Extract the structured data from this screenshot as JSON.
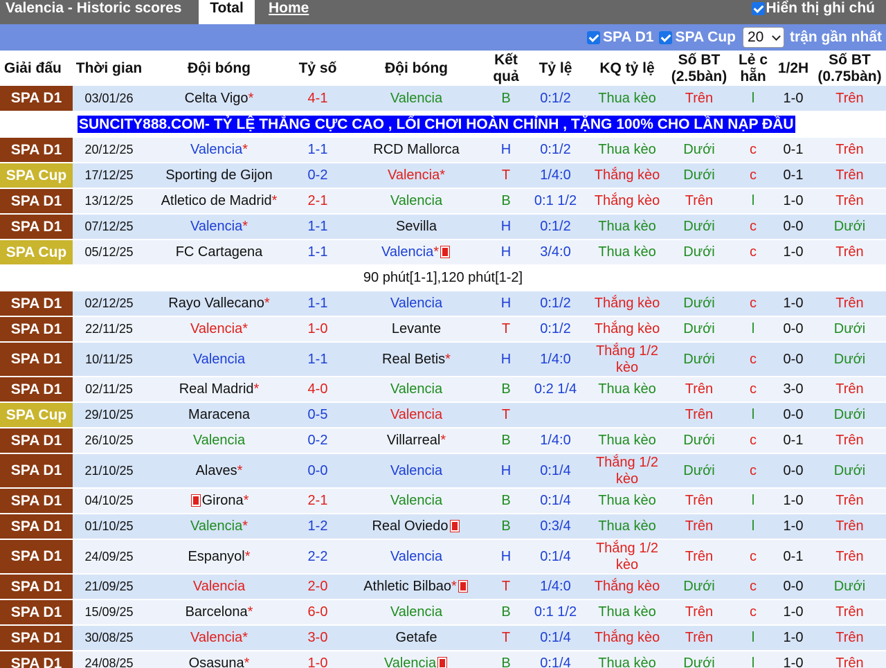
{
  "header": {
    "title": "Valencia - Historic scores",
    "tabs": [
      {
        "label": "Total"
      },
      {
        "label": "Home"
      }
    ],
    "show_note_label": "Hiển thị ghi chú"
  },
  "filters": {
    "league1": "SPA D1",
    "league2": "SPA Cup",
    "count": "20",
    "suffix": "trận gần nhất"
  },
  "columns": [
    "Giải đấu",
    "Thời gian",
    "Đội bóng",
    "Tỷ số",
    "Đội bóng",
    "Kết quả",
    "Tỷ lệ",
    "KQ tỷ lệ",
    "Số BT (2.5bàn)",
    "Lẻ c hẵn",
    "1/2H",
    "Số BT (0.75bàn)"
  ],
  "banner_text": "SUNCITY888.COM- TỶ LỆ THẮNG CỰC CAO , LỐI CHƠI HOÀN CHỈNH , TẶNG 100% CHO LẦN NẠP ĐẦU",
  "note_text": "90 phút[1-1],120 phút[1-2]",
  "colors": {
    "spa_d1": "#8b3a12",
    "spa_cup": "#c9b52e",
    "win": "#e0201c",
    "draw": "#1c3fd6",
    "loss": "#1f8c1f",
    "banner": "#0000ff"
  },
  "rows": [
    {
      "league": "SPA D1",
      "date": "03/01/26",
      "home": "Celta Vigo",
      "home_star": "*",
      "home_card": false,
      "home_color": "dark",
      "score": "4-1",
      "score_color": "red",
      "away": "Valencia",
      "away_star": "",
      "away_card": false,
      "away_color": "green",
      "result": "B",
      "result_color": "green",
      "odds": "0:1/2",
      "odds_result": "Thua kèo",
      "odds_result_color": "green",
      "ou": "Trên",
      "ou_color": "red",
      "oe": "l",
      "oe_color": "green",
      "half": "1-0",
      "ou075": "Trên",
      "ou075_color": "red"
    },
    {
      "league": "SPA D1",
      "date": "20/12/25",
      "home": "Valencia",
      "home_star": "*",
      "home_card": false,
      "home_color": "blue",
      "score": "1-1",
      "score_color": "blue",
      "away": "RCD Mallorca",
      "away_star": "",
      "away_card": false,
      "away_color": "dark",
      "result": "H",
      "result_color": "blue",
      "odds": "0:1/2",
      "odds_result": "Thua kèo",
      "odds_result_color": "green",
      "ou": "Dưới",
      "ou_color": "green",
      "oe": "c",
      "oe_color": "red",
      "half": "0-1",
      "ou075": "Trên",
      "ou075_color": "red"
    },
    {
      "league": "SPA Cup",
      "date": "17/12/25",
      "home": "Sporting de Gijon",
      "home_star": "",
      "home_card": false,
      "home_color": "dark",
      "score": "0-2",
      "score_color": "blue",
      "away": "Valencia",
      "away_star": "*",
      "away_card": false,
      "away_color": "red",
      "result": "T",
      "result_color": "red",
      "odds": "1/4:0",
      "odds_result": "Thắng kèo",
      "odds_result_color": "red",
      "ou": "Dưới",
      "ou_color": "green",
      "oe": "c",
      "oe_color": "red",
      "half": "0-1",
      "ou075": "Trên",
      "ou075_color": "red"
    },
    {
      "league": "SPA D1",
      "date": "13/12/25",
      "home": "Atletico de Madrid",
      "home_star": "*",
      "home_card": false,
      "home_color": "dark",
      "score": "2-1",
      "score_color": "red",
      "away": "Valencia",
      "away_star": "",
      "away_card": false,
      "away_color": "green",
      "result": "B",
      "result_color": "green",
      "odds": "0:1 1/2",
      "odds_result": "Thắng kèo",
      "odds_result_color": "red",
      "ou": "Trên",
      "ou_color": "red",
      "oe": "l",
      "oe_color": "green",
      "half": "1-0",
      "ou075": "Trên",
      "ou075_color": "red"
    },
    {
      "league": "SPA D1",
      "date": "07/12/25",
      "home": "Valencia",
      "home_star": "*",
      "home_card": false,
      "home_color": "blue",
      "score": "1-1",
      "score_color": "blue",
      "away": "Sevilla",
      "away_star": "",
      "away_card": false,
      "away_color": "dark",
      "result": "H",
      "result_color": "blue",
      "odds": "0:1/2",
      "odds_result": "Thua kèo",
      "odds_result_color": "green",
      "ou": "Dưới",
      "ou_color": "green",
      "oe": "c",
      "oe_color": "red",
      "half": "0-0",
      "ou075": "Dưới",
      "ou075_color": "green"
    },
    {
      "league": "SPA Cup",
      "date": "05/12/25",
      "home": "FC Cartagena",
      "home_star": "",
      "home_card": false,
      "home_color": "dark",
      "score": "1-1",
      "score_color": "blue",
      "away": "Valencia",
      "away_star": "*",
      "away_card": true,
      "away_color": "blue",
      "result": "H",
      "result_color": "blue",
      "odds": "3/4:0",
      "odds_result": "Thua kèo",
      "odds_result_color": "green",
      "ou": "Dưới",
      "ou_color": "green",
      "oe": "c",
      "oe_color": "red",
      "half": "1-0",
      "ou075": "Trên",
      "ou075_color": "red"
    },
    {
      "league": "SPA D1",
      "date": "02/12/25",
      "home": "Rayo Vallecano",
      "home_star": "*",
      "home_card": false,
      "home_color": "dark",
      "score": "1-1",
      "score_color": "blue",
      "away": "Valencia",
      "away_star": "",
      "away_card": false,
      "away_color": "blue",
      "result": "H",
      "result_color": "blue",
      "odds": "0:1/2",
      "odds_result": "Thắng kèo",
      "odds_result_color": "red",
      "ou": "Dưới",
      "ou_color": "green",
      "oe": "c",
      "oe_color": "red",
      "half": "1-0",
      "ou075": "Trên",
      "ou075_color": "red"
    },
    {
      "league": "SPA D1",
      "date": "22/11/25",
      "home": "Valencia",
      "home_star": "*",
      "home_card": false,
      "home_color": "red",
      "score": "1-0",
      "score_color": "red",
      "away": "Levante",
      "away_star": "",
      "away_card": false,
      "away_color": "dark",
      "result": "T",
      "result_color": "red",
      "odds": "0:1/2",
      "odds_result": "Thắng kèo",
      "odds_result_color": "red",
      "ou": "Dưới",
      "ou_color": "green",
      "oe": "l",
      "oe_color": "green",
      "half": "0-0",
      "ou075": "Dưới",
      "ou075_color": "green"
    },
    {
      "league": "SPA D1",
      "date": "10/11/25",
      "home": "Valencia",
      "home_star": "",
      "home_card": false,
      "home_color": "blue",
      "score": "1-1",
      "score_color": "blue",
      "away": "Real Betis",
      "away_star": "*",
      "away_card": false,
      "away_color": "dark",
      "result": "H",
      "result_color": "blue",
      "odds": "1/4:0",
      "odds_result": "Thắng 1/2 kèo",
      "odds_result_color": "red",
      "ou": "Dưới",
      "ou_color": "green",
      "oe": "c",
      "oe_color": "red",
      "half": "0-0",
      "ou075": "Dưới",
      "ou075_color": "green"
    },
    {
      "league": "SPA D1",
      "date": "02/11/25",
      "home": "Real Madrid",
      "home_star": "*",
      "home_card": false,
      "home_color": "dark",
      "score": "4-0",
      "score_color": "red",
      "away": "Valencia",
      "away_star": "",
      "away_card": false,
      "away_color": "green",
      "result": "B",
      "result_color": "green",
      "odds": "0:2 1/4",
      "odds_result": "Thua kèo",
      "odds_result_color": "green",
      "ou": "Trên",
      "ou_color": "red",
      "oe": "c",
      "oe_color": "red",
      "half": "3-0",
      "ou075": "Trên",
      "ou075_color": "red"
    },
    {
      "league": "SPA Cup",
      "date": "29/10/25",
      "home": "Maracena",
      "home_star": "",
      "home_card": false,
      "home_color": "dark",
      "score": "0-5",
      "score_color": "blue",
      "away": "Valencia",
      "away_star": "",
      "away_card": false,
      "away_color": "red",
      "result": "T",
      "result_color": "red",
      "odds": "",
      "odds_result": "",
      "odds_result_color": "green",
      "ou": "Trên",
      "ou_color": "red",
      "oe": "l",
      "oe_color": "green",
      "half": "0-0",
      "ou075": "Dưới",
      "ou075_color": "green"
    },
    {
      "league": "SPA D1",
      "date": "26/10/25",
      "home": "Valencia",
      "home_star": "",
      "home_card": false,
      "home_color": "green",
      "score": "0-2",
      "score_color": "blue",
      "away": "Villarreal",
      "away_star": "*",
      "away_card": false,
      "away_color": "dark",
      "result": "B",
      "result_color": "green",
      "odds": "1/4:0",
      "odds_result": "Thua kèo",
      "odds_result_color": "green",
      "ou": "Dưới",
      "ou_color": "green",
      "oe": "c",
      "oe_color": "red",
      "half": "0-1",
      "ou075": "Trên",
      "ou075_color": "red"
    },
    {
      "league": "SPA D1",
      "date": "21/10/25",
      "home": "Alaves",
      "home_star": "*",
      "home_card": false,
      "home_color": "dark",
      "score": "0-0",
      "score_color": "blue",
      "away": "Valencia",
      "away_star": "",
      "away_card": false,
      "away_color": "blue",
      "result": "H",
      "result_color": "blue",
      "odds": "0:1/4",
      "odds_result": "Thắng 1/2 kèo",
      "odds_result_color": "red",
      "ou": "Dưới",
      "ou_color": "green",
      "oe": "c",
      "oe_color": "red",
      "half": "0-0",
      "ou075": "Dưới",
      "ou075_color": "green"
    },
    {
      "league": "SPA D1",
      "date": "04/10/25",
      "home": "Girona",
      "home_star": "*",
      "home_card": true,
      "home_color": "dark",
      "score": "2-1",
      "score_color": "red",
      "away": "Valencia",
      "away_star": "",
      "away_card": false,
      "away_color": "green",
      "result": "B",
      "result_color": "green",
      "odds": "0:1/4",
      "odds_result": "Thua kèo",
      "odds_result_color": "green",
      "ou": "Trên",
      "ou_color": "red",
      "oe": "l",
      "oe_color": "green",
      "half": "1-0",
      "ou075": "Trên",
      "ou075_color": "red"
    },
    {
      "league": "SPA D1",
      "date": "01/10/25",
      "home": "Valencia",
      "home_star": "*",
      "home_card": false,
      "home_color": "green",
      "score": "1-2",
      "score_color": "blue",
      "away": "Real Oviedo",
      "away_star": "",
      "away_card": true,
      "away_color": "dark",
      "result": "B",
      "result_color": "green",
      "odds": "0:3/4",
      "odds_result": "Thua kèo",
      "odds_result_color": "green",
      "ou": "Trên",
      "ou_color": "red",
      "oe": "l",
      "oe_color": "green",
      "half": "1-0",
      "ou075": "Trên",
      "ou075_color": "red"
    },
    {
      "league": "SPA D1",
      "date": "24/09/25",
      "home": "Espanyol",
      "home_star": "*",
      "home_card": false,
      "home_color": "dark",
      "score": "2-2",
      "score_color": "blue",
      "away": "Valencia",
      "away_star": "",
      "away_card": false,
      "away_color": "blue",
      "result": "H",
      "result_color": "blue",
      "odds": "0:1/4",
      "odds_result": "Thắng 1/2 kèo",
      "odds_result_color": "red",
      "ou": "Trên",
      "ou_color": "red",
      "oe": "c",
      "oe_color": "red",
      "half": "0-1",
      "ou075": "Trên",
      "ou075_color": "red"
    },
    {
      "league": "SPA D1",
      "date": "21/09/25",
      "home": "Valencia",
      "home_star": "",
      "home_card": false,
      "home_color": "red",
      "score": "2-0",
      "score_color": "red",
      "away": "Athletic Bilbao",
      "away_star": "*",
      "away_card": true,
      "away_color": "dark",
      "result": "T",
      "result_color": "red",
      "odds": "1/4:0",
      "odds_result": "Thắng kèo",
      "odds_result_color": "red",
      "ou": "Dưới",
      "ou_color": "green",
      "oe": "c",
      "oe_color": "red",
      "half": "0-0",
      "ou075": "Dưới",
      "ou075_color": "green"
    },
    {
      "league": "SPA D1",
      "date": "15/09/25",
      "home": "Barcelona",
      "home_star": "*",
      "home_card": false,
      "home_color": "dark",
      "score": "6-0",
      "score_color": "red",
      "away": "Valencia",
      "away_star": "",
      "away_card": false,
      "away_color": "green",
      "result": "B",
      "result_color": "green",
      "odds": "0:1 1/2",
      "odds_result": "Thua kèo",
      "odds_result_color": "green",
      "ou": "Trên",
      "ou_color": "red",
      "oe": "c",
      "oe_color": "red",
      "half": "1-0",
      "ou075": "Trên",
      "ou075_color": "red"
    },
    {
      "league": "SPA D1",
      "date": "30/08/25",
      "home": "Valencia",
      "home_star": "*",
      "home_card": false,
      "home_color": "red",
      "score": "3-0",
      "score_color": "red",
      "away": "Getafe",
      "away_star": "",
      "away_card": false,
      "away_color": "dark",
      "result": "T",
      "result_color": "red",
      "odds": "0:1/4",
      "odds_result": "Thắng kèo",
      "odds_result_color": "red",
      "ou": "Trên",
      "ou_color": "red",
      "oe": "l",
      "oe_color": "green",
      "half": "1-0",
      "ou075": "Trên",
      "ou075_color": "red"
    },
    {
      "league": "SPA D1",
      "date": "24/08/25",
      "home": "Osasuna",
      "home_star": "*",
      "home_card": false,
      "home_color": "dark",
      "score": "1-0",
      "score_color": "red",
      "away": "Valencia",
      "away_star": "",
      "away_card": true,
      "away_color": "green",
      "result": "B",
      "result_color": "green",
      "odds": "0:1/4",
      "odds_result": "Thua kèo",
      "odds_result_color": "green",
      "ou": "Dưới",
      "ou_color": "green",
      "oe": "l",
      "oe_color": "green",
      "half": "1-0",
      "ou075": "Trên",
      "ou075_color": "red"
    }
  ]
}
